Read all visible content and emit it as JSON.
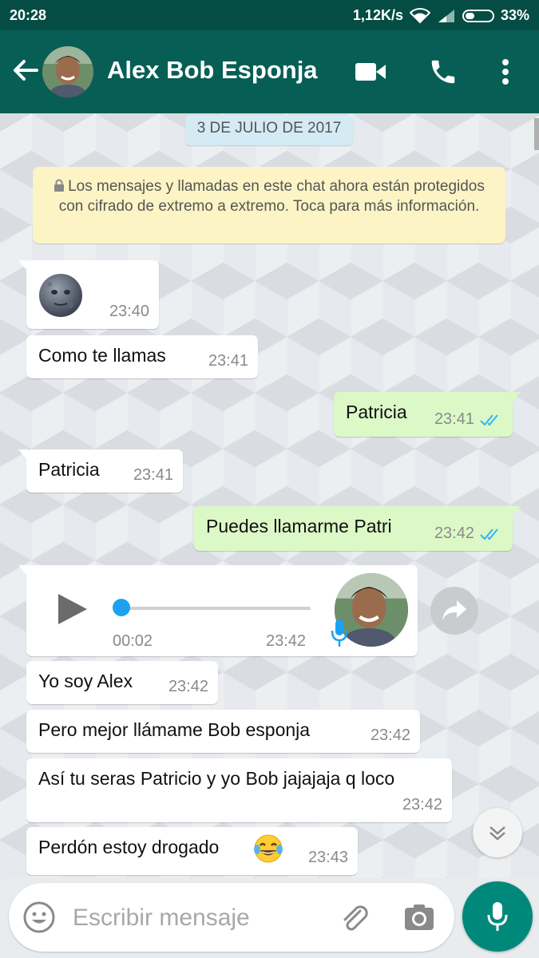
{
  "status_bar": {
    "time": "20:28",
    "network_speed": "1,12K/s",
    "battery": "33%",
    "battery_level": 0.33
  },
  "header": {
    "contact_name": "Alex Bob Esponja"
  },
  "chat": {
    "date_chip": "3 DE JULIO DE 2017",
    "encryption_notice": "Los mensajes y llamadas en este chat ahora están protegidos con cifrado de extremo a extremo. Toca para más información.",
    "messages": [
      {
        "direction": "in",
        "text": "",
        "emoji": "new-moon-face-emoji",
        "time": "23:40"
      },
      {
        "direction": "in",
        "text": "Como te llamas",
        "time": "23:41"
      },
      {
        "direction": "out",
        "text": "Patricia",
        "time": "23:41",
        "status": "read"
      },
      {
        "direction": "in",
        "text": "Patricia",
        "time": "23:41"
      },
      {
        "direction": "out",
        "text": "Puedes llamarme Patri",
        "time": "23:42",
        "status": "read"
      },
      {
        "direction": "in",
        "type": "voice",
        "duration": "00:02",
        "time": "23:42",
        "progress": 0
      },
      {
        "direction": "in",
        "text": "Yo soy Alex",
        "time": "23:42"
      },
      {
        "direction": "in",
        "text": "Pero mejor llámame Bob esponja",
        "time": "23:42"
      },
      {
        "direction": "in",
        "text": "Así tu seras Patricio y yo Bob jajajaja q loco",
        "time": "23:42"
      },
      {
        "direction": "in",
        "text": "Perdón estoy drogado",
        "emoji": "tears-of-joy-emoji",
        "time": "23:43"
      }
    ]
  },
  "composer": {
    "placeholder": "Escribir mensaje"
  },
  "colors": {
    "header": "#075e54",
    "status_bar": "#054d44",
    "outgoing_bubble": "#dcf8c6",
    "accent": "#00897b",
    "read_ticks": "#34b7f1"
  }
}
